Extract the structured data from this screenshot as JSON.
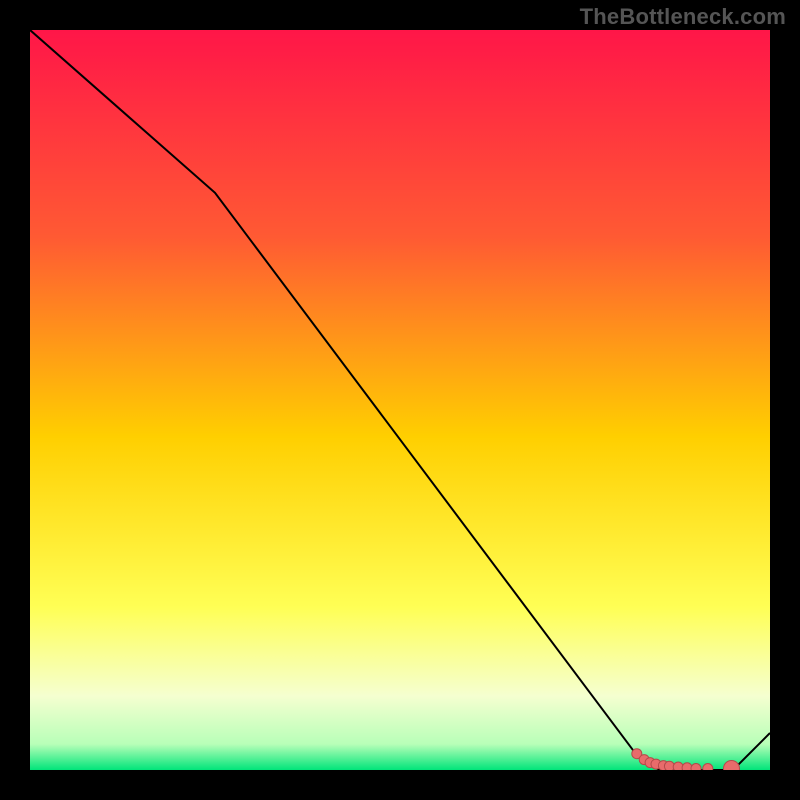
{
  "watermark": "TheBottleneck.com",
  "colors": {
    "bg_black": "#000000",
    "line": "#000000",
    "marker_fill": "#e86b6b",
    "marker_stroke": "#b44a4a",
    "grad_top": "#ff1648",
    "grad_upper_mid": "#ff6a2a",
    "grad_mid": "#ffd400",
    "grad_lower_mid": "#ffff60",
    "grad_pale": "#f8ffd0",
    "grad_green": "#00e57a"
  },
  "chart_data": {
    "type": "line",
    "title": "",
    "xlabel": "",
    "ylabel": "",
    "x": [
      0.0,
      0.25,
      0.82,
      0.85,
      0.95,
      1.0
    ],
    "values": [
      1.0,
      0.78,
      0.02,
      0.0,
      0.0,
      0.05
    ],
    "ylim": [
      0,
      1
    ],
    "xlim": [
      0,
      1
    ],
    "markers": {
      "x": [
        0.82,
        0.83,
        0.838,
        0.846,
        0.856,
        0.864,
        0.876,
        0.888,
        0.9,
        0.916,
        0.948
      ],
      "y": [
        0.022,
        0.014,
        0.01,
        0.008,
        0.006,
        0.005,
        0.004,
        0.003,
        0.002,
        0.002,
        0.002
      ],
      "r": [
        5,
        5,
        5,
        5,
        5,
        5,
        5,
        5,
        5,
        5,
        8
      ]
    },
    "gradient_stops": [
      {
        "offset": 0.0,
        "color": "#ff1648"
      },
      {
        "offset": 0.28,
        "color": "#ff5a33"
      },
      {
        "offset": 0.55,
        "color": "#ffcf00"
      },
      {
        "offset": 0.78,
        "color": "#ffff55"
      },
      {
        "offset": 0.9,
        "color": "#f5ffd0"
      },
      {
        "offset": 0.965,
        "color": "#b8ffb8"
      },
      {
        "offset": 1.0,
        "color": "#00e57a"
      }
    ]
  }
}
